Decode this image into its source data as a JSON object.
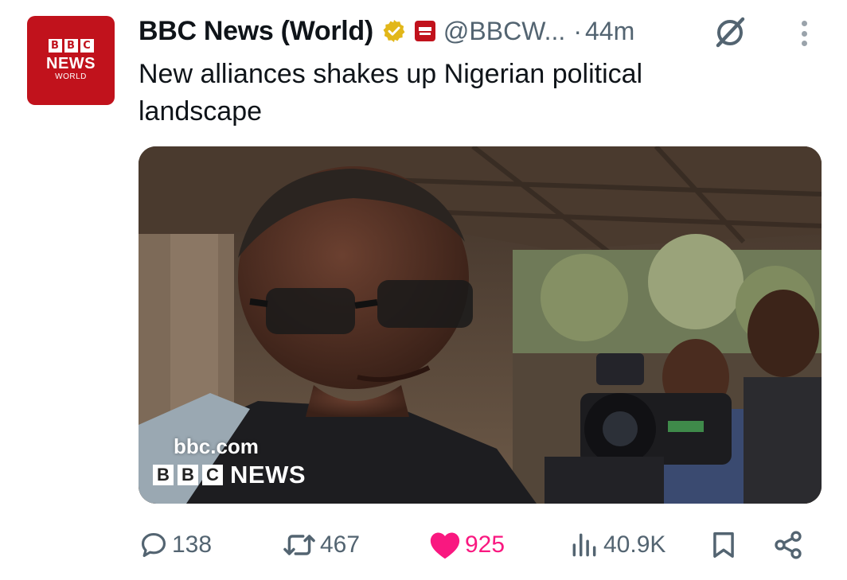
{
  "avatar": {
    "blocks": [
      "B",
      "B",
      "C"
    ],
    "line1": "NEWS",
    "line2": "WORLD"
  },
  "post": {
    "author": "BBC News (World)",
    "handle": "@BBCW...",
    "separator": "·",
    "time": "44m",
    "text": "New alliances shakes up Nigerian political landscape"
  },
  "media": {
    "watermark_site": "bbc.com",
    "watermark_blocks": [
      "B",
      "B",
      "C"
    ],
    "watermark_brand": "NEWS"
  },
  "actions": {
    "replies": "138",
    "reposts": "467",
    "likes": "925",
    "views": "40.9K"
  },
  "colors": {
    "brand_red": "#c1121c",
    "like_pink": "#f91880",
    "muted": "#536471",
    "verified_gold": "#e2b719"
  },
  "icons": [
    "verified-badge-icon",
    "grok-icon",
    "more-icon",
    "reply-icon",
    "repost-icon",
    "like-icon",
    "views-icon",
    "bookmark-icon",
    "share-icon"
  ]
}
